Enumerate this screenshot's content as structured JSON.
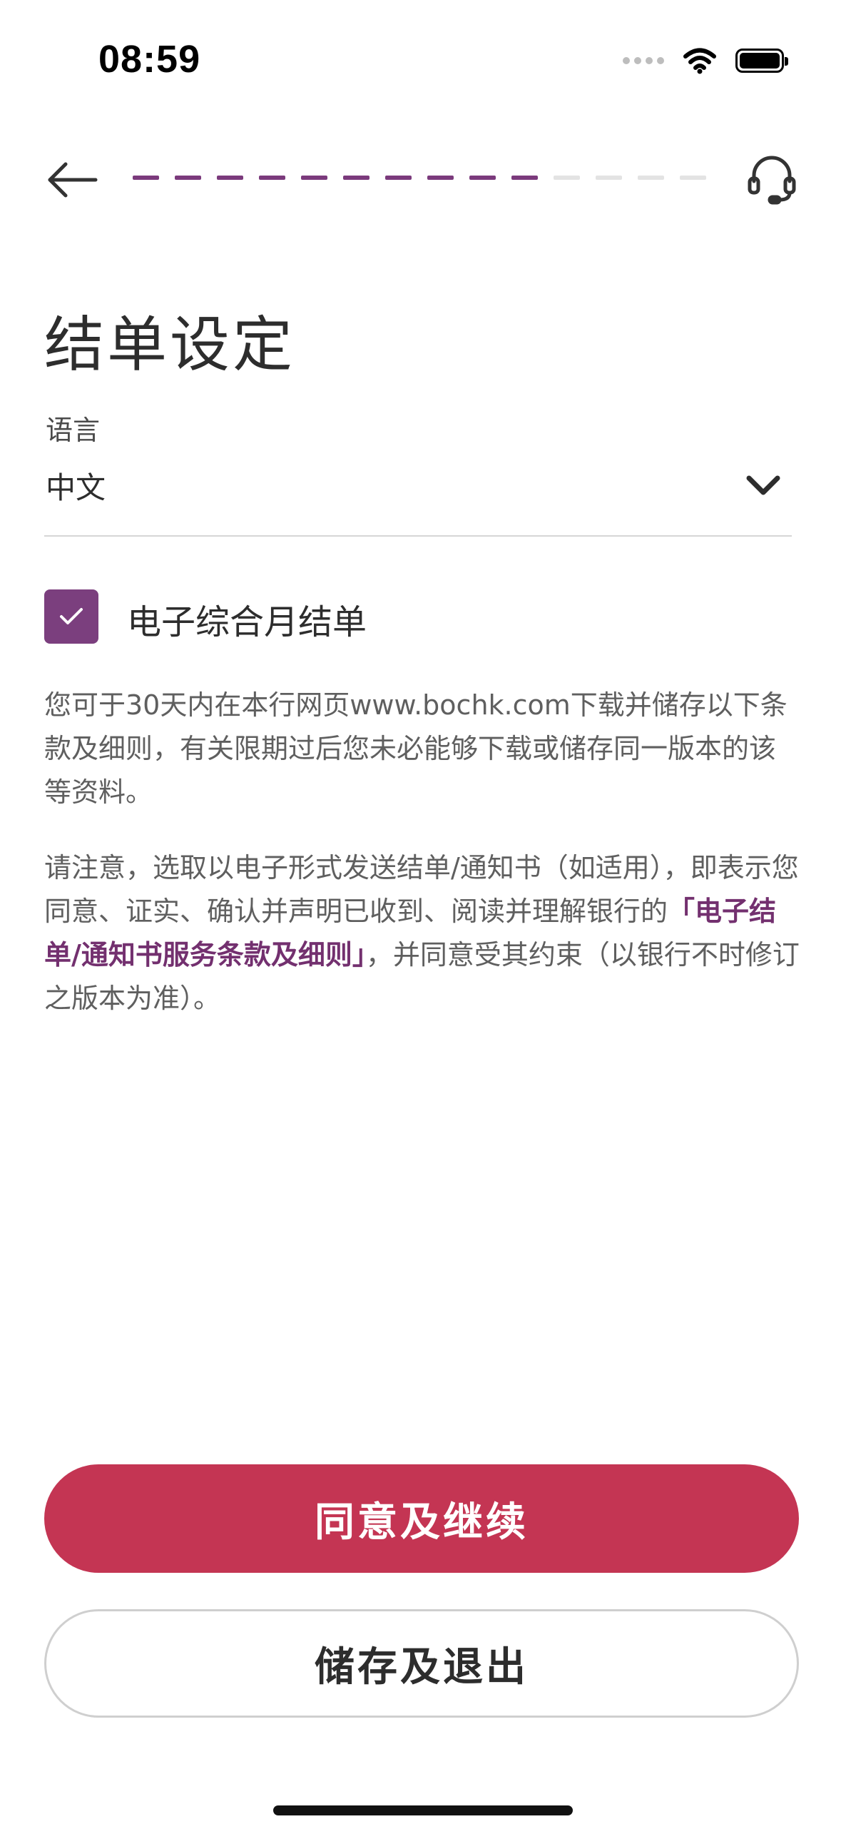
{
  "status_bar": {
    "time": "08:59"
  },
  "header": {
    "back_icon": "arrow-left-icon",
    "support_icon": "headset-icon",
    "progress": {
      "total_steps": 14,
      "completed_steps": 10
    }
  },
  "page": {
    "title": "结单设定"
  },
  "language": {
    "label": "语言",
    "value": "中文"
  },
  "statement_option": {
    "label": "电子综合月结单",
    "checked": true
  },
  "notice": {
    "paragraph1": "您可于30天内在本行网页www.bochk.com下载并储存以下条款及细则，有关限期过后您未必能够下载或储存同一版本的该等资料。",
    "paragraph2_before": "请注意，选取以电子形式发送结单/通知书（如适用），即表示您同意、证实、确认并声明已收到、阅读并理解银行的",
    "paragraph2_link": "「电子结单/通知书服务条款及细则」",
    "paragraph2_after": "，并同意受其约束（以银行不时修订之版本为准）。"
  },
  "actions": {
    "primary_label": "同意及继续",
    "secondary_label": "储存及退出"
  },
  "colors": {
    "brand_purple": "#7b3a7c",
    "primary_button": "#c43553",
    "progress_inactive": "#e3e3e3"
  }
}
